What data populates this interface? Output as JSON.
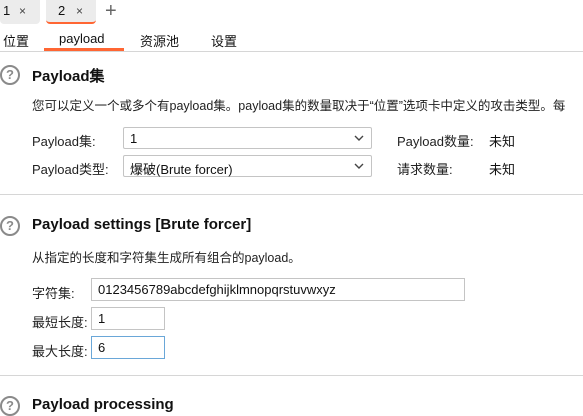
{
  "request_tabs": [
    {
      "label": "1",
      "close": "×"
    },
    {
      "label": "2",
      "close": "×"
    }
  ],
  "add_tab": "+",
  "sub_tabs": [
    "位置",
    "payload",
    "资源池",
    "设置"
  ],
  "payload_sets": {
    "title": "Payload集",
    "description": "您可以定义一个或多个有payload集。payload集的数量取决于“位置”选项卡中定义的攻击类型。每",
    "set_label": "Payload集:",
    "set_value": "1",
    "type_label": "Payload类型:",
    "type_value": "爆破(Brute forcer)",
    "count_label": "Payload数量:",
    "count_value": "未知",
    "requests_label": "请求数量:",
    "requests_value": "未知"
  },
  "payload_settings": {
    "title": "Payload settings [Brute forcer]",
    "description": "从指定的长度和字符集生成所有组合的payload。",
    "charset_label": "字符集:",
    "charset_value": "0123456789abcdefghijklmnopqrstuvwxyz",
    "min_label": "最短长度:",
    "min_value": "1",
    "max_label": "最大长度:",
    "max_value": "6"
  },
  "payload_processing": {
    "title": "Payload processing"
  }
}
